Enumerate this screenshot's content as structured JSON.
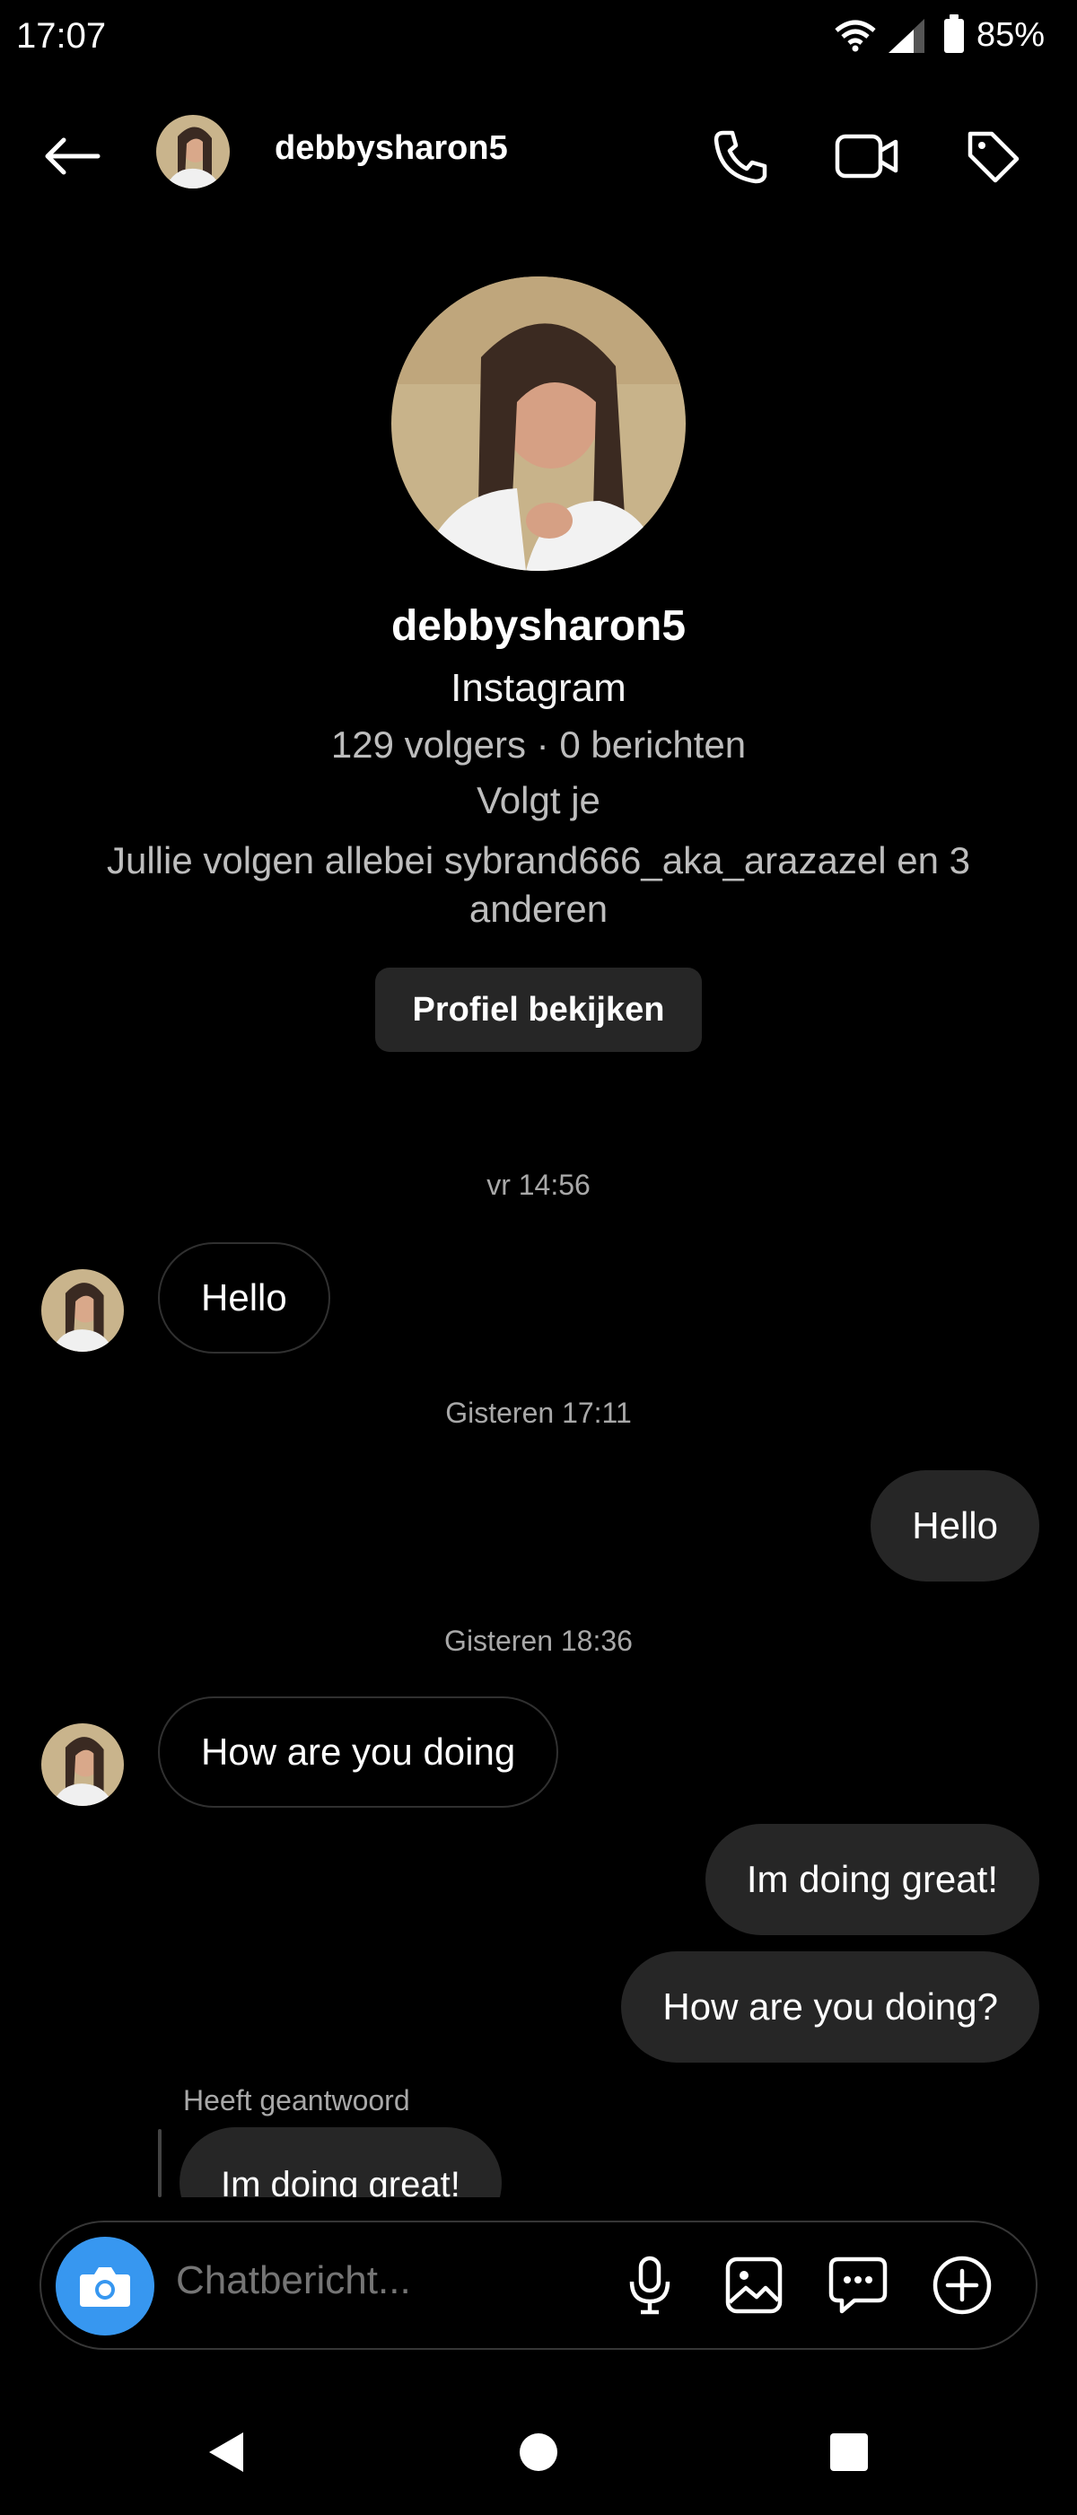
{
  "status_bar": {
    "time": "17:07",
    "battery": "85%"
  },
  "header": {
    "username": "debbysharon5"
  },
  "profile": {
    "username": "debbysharon5",
    "platform": "Instagram",
    "stats": "129 volgers · 0 berichten",
    "follow_status": "Volgt je",
    "mutual": "Jullie volgen allebei sybrand666_aka_arazazel en 3 anderen",
    "view_button": "Profiel bekijken"
  },
  "messages": [
    {
      "type": "timestamp",
      "text": "vr 14:56"
    },
    {
      "type": "incoming",
      "text": "Hello"
    },
    {
      "type": "timestamp",
      "text": "Gisteren 17:11"
    },
    {
      "type": "outgoing",
      "text": "Hello"
    },
    {
      "type": "timestamp",
      "text": "Gisteren 18:36"
    },
    {
      "type": "incoming",
      "text": "How are you doing"
    },
    {
      "type": "outgoing",
      "text": "Im doing great!"
    },
    {
      "type": "outgoing",
      "text": "How are you doing?"
    }
  ],
  "reply": {
    "label": "Heeft geantwoord",
    "quoted": "Im doing great!"
  },
  "composer": {
    "placeholder": "Chatbericht..."
  },
  "icons": {
    "back": "arrow-left-icon",
    "call": "phone-icon",
    "video": "video-camera-icon",
    "tag": "tag-icon",
    "camera": "camera-icon",
    "mic": "microphone-icon",
    "gallery": "image-icon",
    "sticker": "chat-bubble-icon",
    "more": "plus-circle-icon"
  },
  "colors": {
    "accent": "#3797f0",
    "bubble_out": "#262626",
    "background": "#000000"
  }
}
